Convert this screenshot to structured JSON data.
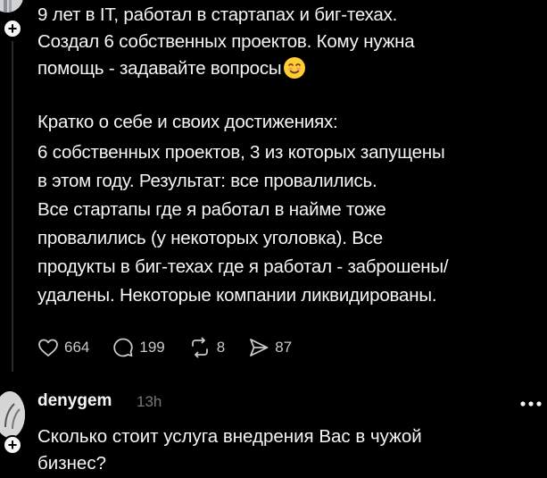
{
  "post": {
    "intro_lines": [
      "9 лет в IT, работал в стартапах и биг-техах.",
      "Создал 6 собственных проектов. Кому нужна",
      "помощь - задавайте вопросы"
    ],
    "body_lines": [
      "Кратко о себе и своих достижениях:",
      "6 собственных проектов, 3 из которых запущены",
      "в этом году. Результат: все провалились.",
      "Все стартапы где я работал в найме тоже",
      "провалились (у некоторых уголовка). Все",
      "продукты в биг-техах где я работал - заброшены/",
      "удалены. Некоторые компании ликвидированы."
    ],
    "emoji": "smiling-face-emoji",
    "actions": {
      "likes": "664",
      "comments": "199",
      "reposts": "8",
      "shares": "87"
    }
  },
  "reply": {
    "username": "denygem",
    "time": "13h",
    "text_lines": [
      "Сколько стоит услуга внедрения Вас в чужой",
      "бизнес?"
    ]
  },
  "colors": {
    "background": "#000000",
    "text": "#f3f5f7",
    "muted": "#777777",
    "icon": "#c9c9c9"
  }
}
